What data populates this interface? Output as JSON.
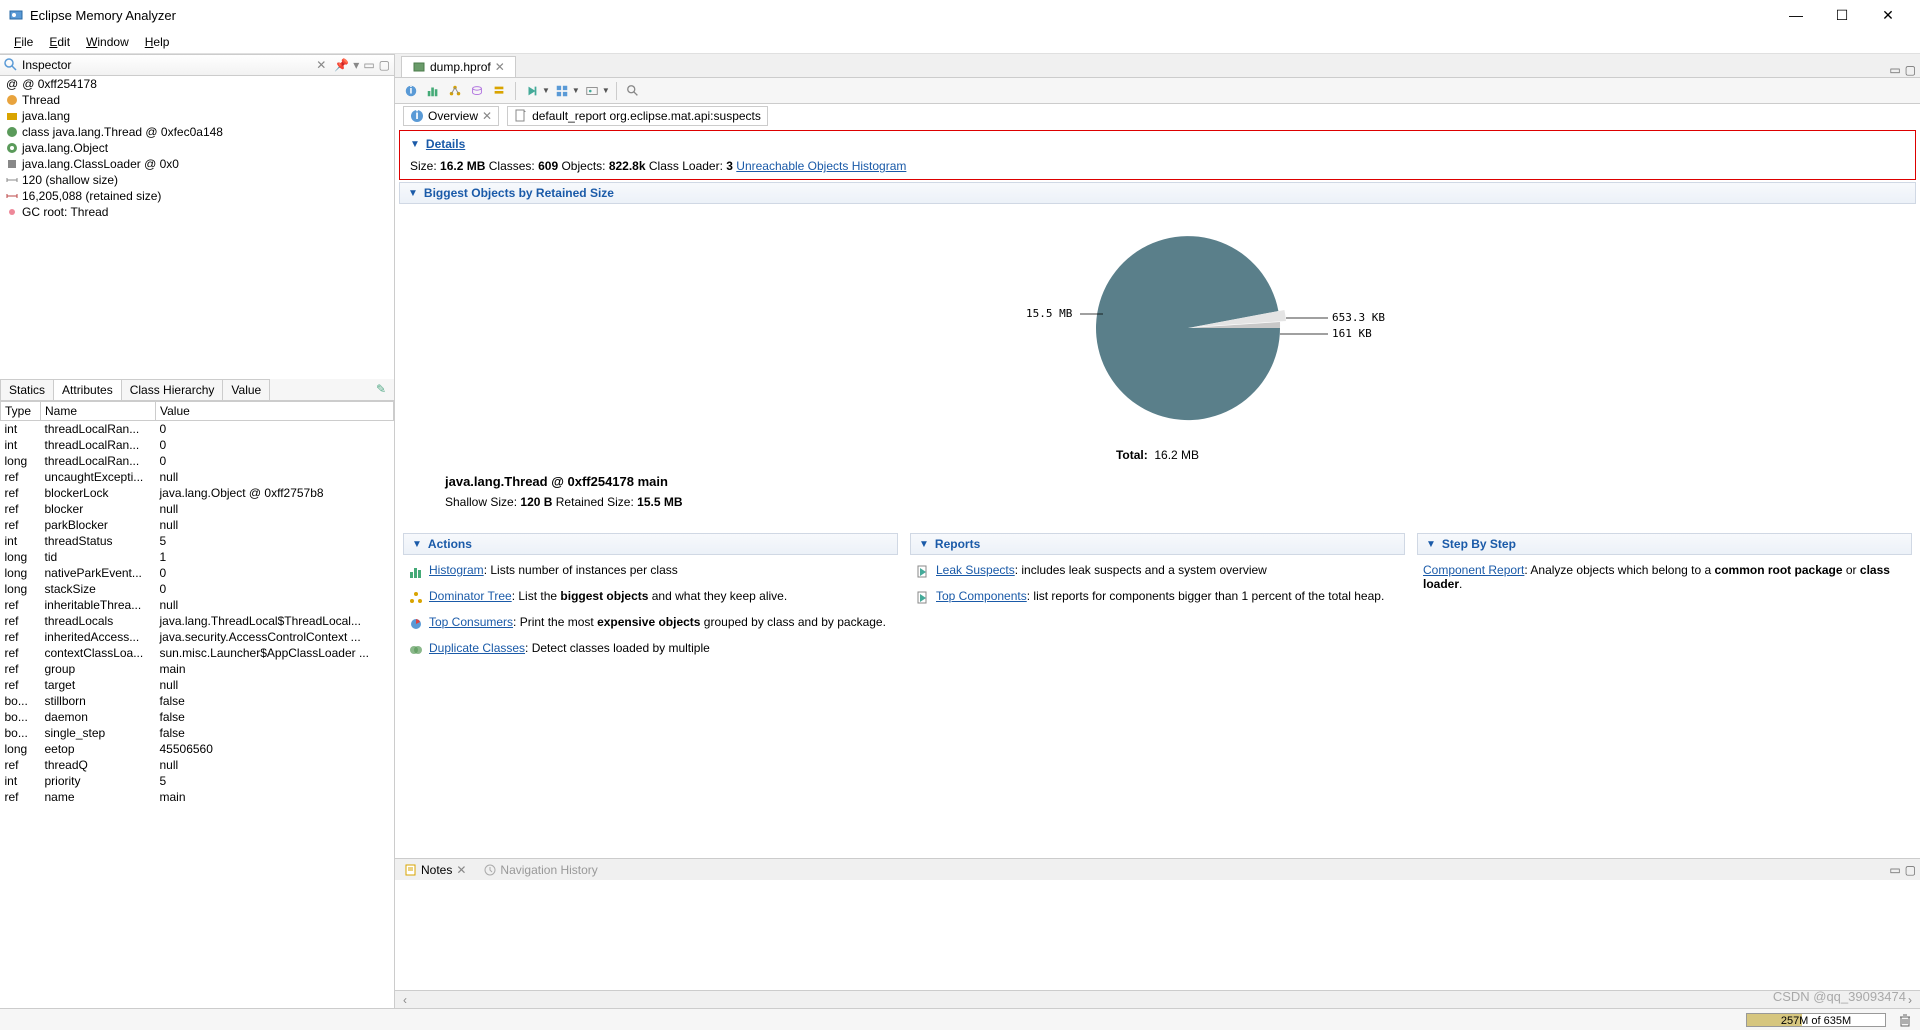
{
  "window": {
    "title": "Eclipse Memory Analyzer"
  },
  "menu": {
    "file": "File",
    "edit": "Edit",
    "window": "Window",
    "help": "Help"
  },
  "inspector": {
    "title": "Inspector",
    "rows": [
      "@ 0xff254178",
      "Thread",
      "java.lang",
      "class java.lang.Thread @ 0xfec0a148",
      "java.lang.Object",
      "java.lang.ClassLoader @ 0x0",
      "120 (shallow size)",
      "16,205,088 (retained size)",
      "GC root: Thread"
    ],
    "tabs": [
      "Statics",
      "Attributes",
      "Class Hierarchy",
      "Value"
    ],
    "active_tab": 1,
    "columns": [
      "Type",
      "Name",
      "Value"
    ],
    "attrs": [
      {
        "type": "int",
        "name": "threadLocalRan...",
        "value": "0"
      },
      {
        "type": "int",
        "name": "threadLocalRan...",
        "value": "0"
      },
      {
        "type": "long",
        "name": "threadLocalRan...",
        "value": "0"
      },
      {
        "type": "ref",
        "name": "uncaughtExcepti...",
        "value": "null"
      },
      {
        "type": "ref",
        "name": "blockerLock",
        "value": "java.lang.Object @ 0xff2757b8"
      },
      {
        "type": "ref",
        "name": "blocker",
        "value": "null"
      },
      {
        "type": "ref",
        "name": "parkBlocker",
        "value": "null"
      },
      {
        "type": "int",
        "name": "threadStatus",
        "value": "5"
      },
      {
        "type": "long",
        "name": "tid",
        "value": "1"
      },
      {
        "type": "long",
        "name": "nativeParkEvent...",
        "value": "0"
      },
      {
        "type": "long",
        "name": "stackSize",
        "value": "0"
      },
      {
        "type": "ref",
        "name": "inheritableThrea...",
        "value": "null"
      },
      {
        "type": "ref",
        "name": "threadLocals",
        "value": "java.lang.ThreadLocal$ThreadLocal..."
      },
      {
        "type": "ref",
        "name": "inheritedAccess...",
        "value": "java.security.AccessControlContext ..."
      },
      {
        "type": "ref",
        "name": "contextClassLoa...",
        "value": "sun.misc.Launcher$AppClassLoader ..."
      },
      {
        "type": "ref",
        "name": "group",
        "value": "main"
      },
      {
        "type": "ref",
        "name": "target",
        "value": "null"
      },
      {
        "type": "bo...",
        "name": "stillborn",
        "value": "false"
      },
      {
        "type": "bo...",
        "name": "daemon",
        "value": "false"
      },
      {
        "type": "bo...",
        "name": "single_step",
        "value": "false"
      },
      {
        "type": "long",
        "name": "eetop",
        "value": "45506560"
      },
      {
        "type": "ref",
        "name": "threadQ",
        "value": "null"
      },
      {
        "type": "int",
        "name": "priority",
        "value": "5"
      },
      {
        "type": "ref",
        "name": "name",
        "value": "main"
      }
    ]
  },
  "editor": {
    "tab": "dump.hprof",
    "subtabs": {
      "overview": "Overview",
      "report": "default_report  org.eclipse.mat.api:suspects"
    }
  },
  "details": {
    "header": "Details",
    "size_label": "Size:",
    "size": "16.2 MB",
    "classes_label": "Classes:",
    "classes": "609",
    "objects_label": "Objects:",
    "objects": "822.8k",
    "loader_label": "Class Loader:",
    "loader": "3",
    "link": "Unreachable Objects Histogram"
  },
  "biggest": {
    "header": "Biggest Objects by Retained Size",
    "slice1": "15.5 MB",
    "slice2": "653.3 KB",
    "slice3": "161 KB",
    "total_label": "Total:",
    "total": "16.2 MB",
    "object_label": "java.lang.Thread @ 0xff254178 main",
    "shallow_label": "Shallow Size:",
    "shallow": "120 B",
    "retained_label": "Retained Size:",
    "retained": "15.5 MB"
  },
  "actions": {
    "header": "Actions",
    "histogram": "Histogram",
    "histogram_desc": ": Lists number of instances per class",
    "dominator": "Dominator Tree",
    "dominator_desc1": ": List the ",
    "dominator_bold": "biggest objects",
    "dominator_desc2": " and what they keep alive.",
    "consumers": "Top Consumers",
    "consumers_desc1": ": Print the most ",
    "consumers_bold": "expensive objects",
    "consumers_desc2": " grouped by class and by package.",
    "duplicates": "Duplicate Classes",
    "duplicates_desc": ": Detect classes loaded by multiple"
  },
  "reports": {
    "header": "Reports",
    "leak": "Leak Suspects",
    "leak_desc": ": includes leak suspects and a system overview",
    "top": "Top Components",
    "top_desc": ": list reports for components bigger than 1 percent of the total heap."
  },
  "stepbystep": {
    "header": "Step By Step",
    "comp": "Component Report",
    "comp_desc1": ": Analyze objects which belong to a ",
    "comp_bold1": "common root package",
    "comp_desc2": " or ",
    "comp_bold2": "class loader",
    "comp_desc3": "."
  },
  "notes": {
    "notes_tab": "Notes",
    "nav_tab": "Navigation History"
  },
  "status": {
    "mem": "257M of 635M",
    "mem_pct": 40
  },
  "watermark": "CSDN @qq_39093474",
  "chart_data": {
    "type": "pie",
    "title": "Biggest Objects by Retained Size",
    "total_label": "Total",
    "total": "16.2 MB",
    "slices": [
      {
        "label": "15.5 MB",
        "value_mb": 15.5,
        "color": "#5a7f8a"
      },
      {
        "label": "653.3 KB",
        "value_mb": 0.638,
        "color": "#e4e4e4"
      },
      {
        "label": "161 KB",
        "value_mb": 0.157,
        "color": "#c8c8c8"
      }
    ],
    "selected_object": {
      "name": "java.lang.Thread @ 0xff254178 main",
      "shallow_size": "120 B",
      "retained_size": "15.5 MB"
    }
  }
}
